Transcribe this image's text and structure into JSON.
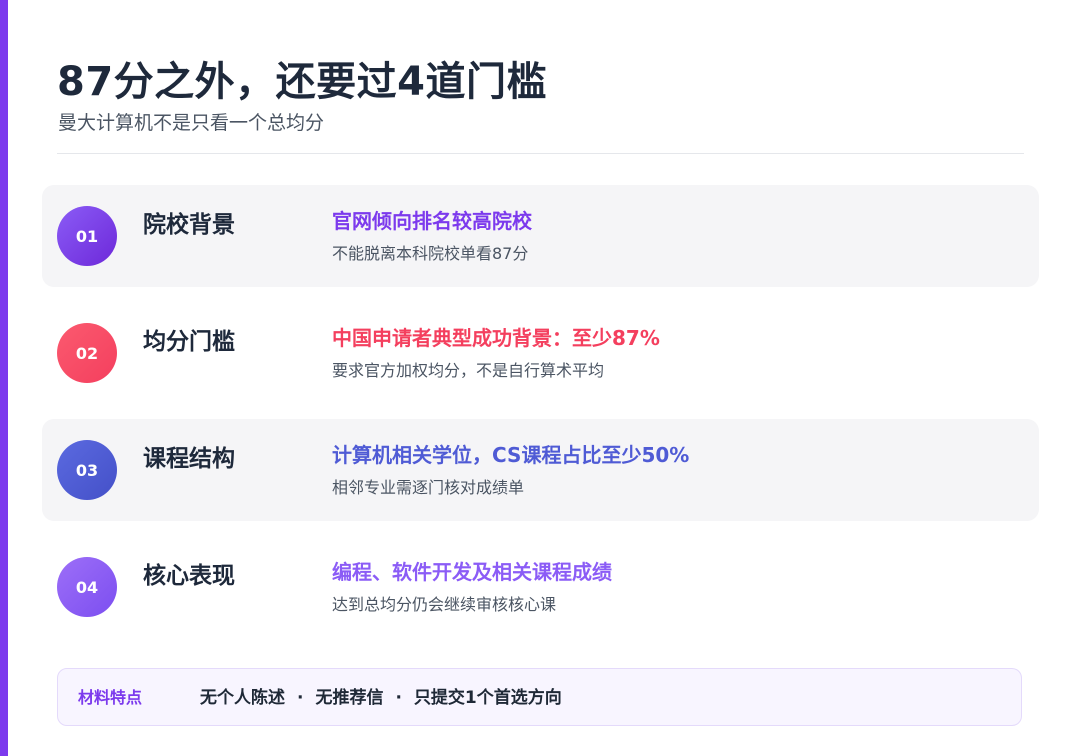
{
  "header": {
    "title": "87分之外，还要过4道门槛",
    "subtitle": "曼大计算机不是只看一个总均分"
  },
  "rows": [
    {
      "number": "01",
      "label": "院校背景",
      "headline": "官网倾向排名较高院校",
      "desc": "不能脱离本科院校单看87分",
      "color": "#7c3aed"
    },
    {
      "number": "02",
      "label": "均分门槛",
      "headline": "中国申请者典型成功背景：至少87%",
      "desc": "要求官方加权均分，不是自行算术平均",
      "color": "#f43f5e"
    },
    {
      "number": "03",
      "label": "课程结构",
      "headline": "计算机相关学位，CS课程占比至少50%",
      "desc": "相邻专业需逐门核对成绩单",
      "color": "#4f5bd5"
    },
    {
      "number": "04",
      "label": "核心表现",
      "headline": "编程、软件开发及相关课程成绩",
      "desc": "达到总均分仍会继续审核核心课",
      "color": "#8b5cf6"
    }
  ],
  "footer": {
    "label": "材料特点",
    "items": [
      "无个人陈述",
      "无推荐信",
      "只提交1个首选方向"
    ],
    "separator": "·"
  },
  "colors": {
    "accent": "#7c3aed",
    "footer_bg": "#f8f5ff"
  }
}
